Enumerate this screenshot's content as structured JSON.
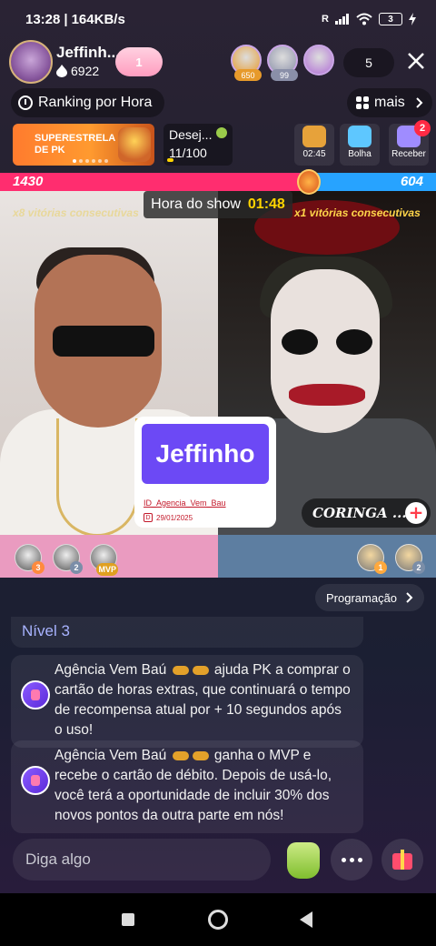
{
  "status_bar": {
    "time": "13:28",
    "speed": "164KB/s",
    "signal": "R",
    "battery": "3"
  },
  "host": {
    "name": "Jeffinh...",
    "fans": "6922",
    "follow_badge": "1"
  },
  "viewers": [
    {
      "badge": "650",
      "color": "#e79a2b"
    },
    {
      "badge": "99",
      "color": "#8a8fa8"
    },
    {
      "badge": "",
      "color": "#b16fd6"
    }
  ],
  "viewer_count": "5",
  "ranking": {
    "label": "Ranking por Hora"
  },
  "more": {
    "label": "mais"
  },
  "pk_banner": {
    "label": "SUPERESTRELA DE PK"
  },
  "wish": {
    "title": "Desej...",
    "progress_text": "11/100",
    "progress_fraction": 0.11
  },
  "tools": [
    {
      "name": "chest",
      "label": "02:45",
      "color": "#e7a23a"
    },
    {
      "name": "bubble",
      "label": "Bolha",
      "color": "#5ec7ff"
    },
    {
      "name": "receive",
      "label": "Receber",
      "color": "#9f8cff",
      "badge": "2"
    }
  ],
  "pk": {
    "left_score": "1430",
    "right_score": "604",
    "left_streak": "x8 vitórias consecutivas",
    "right_streak": "x1 vitórias consecutivas",
    "timer_label": "Hora do show",
    "timer_value": "01:48"
  },
  "name_card": {
    "name": "Jeffinho",
    "id": "ID_Agencia_Vem_Bau",
    "date": "29/01/2025",
    "date_icon": "D"
  },
  "opponent": {
    "name": "CORINGA ...",
    "follow_label": "+"
  },
  "supporters_left": [
    {
      "badge": "3",
      "color": "#ff8a3d"
    },
    {
      "badge": "2",
      "color": "#7b8ea8"
    },
    {
      "badge": "MVP",
      "color": "#e0a020"
    }
  ],
  "supporters_right": [
    {
      "badge": "1",
      "color": "#ffa93d"
    },
    {
      "badge": "2",
      "color": "#7b8ea8"
    }
  ],
  "program": {
    "label": "Programação"
  },
  "messages": {
    "level": "Nível 3",
    "items": [
      {
        "author": "Agência Vem Baú",
        "text": "ajuda PK a comprar o cartão de horas extras, que continuará o tempo de recompensa atual por + 10 segundos após o uso!"
      },
      {
        "author": "Agência Vem Baú",
        "text": "ganha o MVP e recebe o cartão de débito. Depois de usá-lo, você terá a oportunidade de incluir 30% dos novos pontos da outra parte em nós!"
      }
    ]
  },
  "input": {
    "placeholder": "Diga algo"
  }
}
